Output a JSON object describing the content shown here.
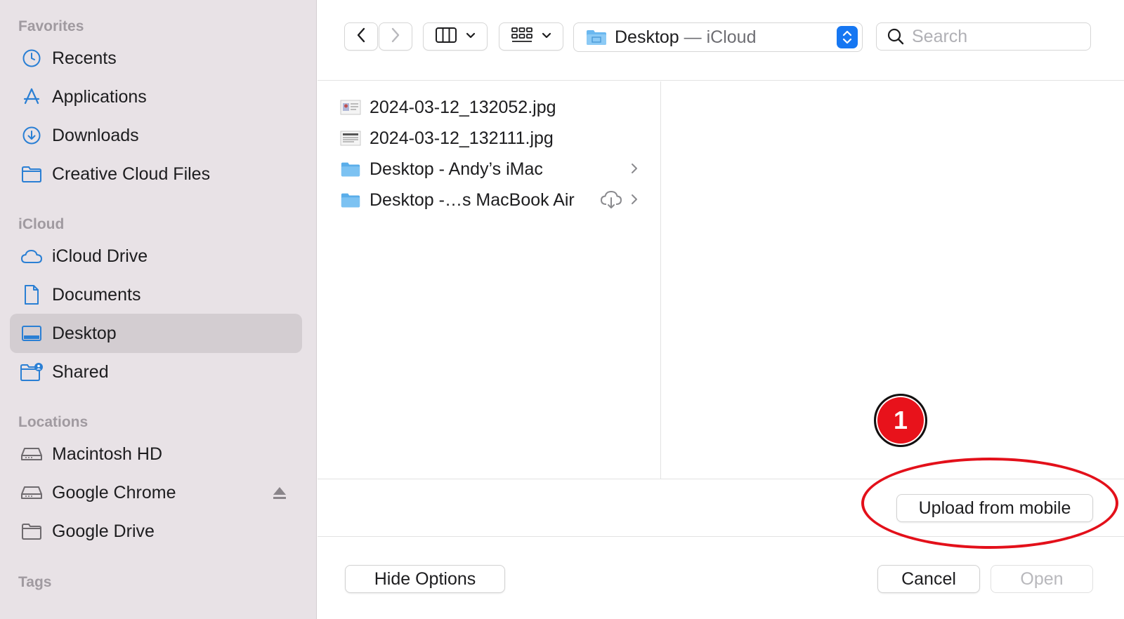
{
  "sidebar": {
    "sections": {
      "favorites": "Favorites",
      "icloud": "iCloud",
      "locations": "Locations",
      "tags": "Tags"
    },
    "favorites": [
      {
        "label": "Recents",
        "icon": "clock-icon"
      },
      {
        "label": "Applications",
        "icon": "applications-icon"
      },
      {
        "label": "Downloads",
        "icon": "download-icon"
      },
      {
        "label": "Creative Cloud Files",
        "icon": "folder-icon"
      }
    ],
    "icloud": [
      {
        "label": "iCloud Drive",
        "icon": "cloud-icon"
      },
      {
        "label": "Documents",
        "icon": "document-icon"
      },
      {
        "label": "Desktop",
        "icon": "desktop-icon",
        "selected": true
      },
      {
        "label": "Shared",
        "icon": "shared-folder-icon"
      }
    ],
    "locations": [
      {
        "label": "Macintosh HD",
        "icon": "drive-icon"
      },
      {
        "label": "Google Chrome",
        "icon": "drive-icon",
        "ejectable": true
      },
      {
        "label": "Google Drive",
        "icon": "folder-icon"
      }
    ]
  },
  "toolbar": {
    "location_name": "Desktop",
    "location_sub": " — iCloud",
    "search_placeholder": "Search"
  },
  "files": [
    {
      "name": "2024-03-12_132052.jpg",
      "type": "image"
    },
    {
      "name": "2024-03-12_132111.jpg",
      "type": "image"
    },
    {
      "name": "Desktop - Andy’s iMac",
      "type": "folder"
    },
    {
      "name": "Desktop -…s MacBook Air",
      "type": "folder",
      "cloud": true
    }
  ],
  "buttons": {
    "upload": "Upload from mobile",
    "hide_options": "Hide Options",
    "cancel": "Cancel",
    "open": "Open"
  },
  "annotation": {
    "badge": "1",
    "color": "#e3101a"
  },
  "colors": {
    "accent": "#1677f2",
    "sidebar_bg": "#e8e2e6",
    "icon_blue": "#2a7fd4"
  }
}
